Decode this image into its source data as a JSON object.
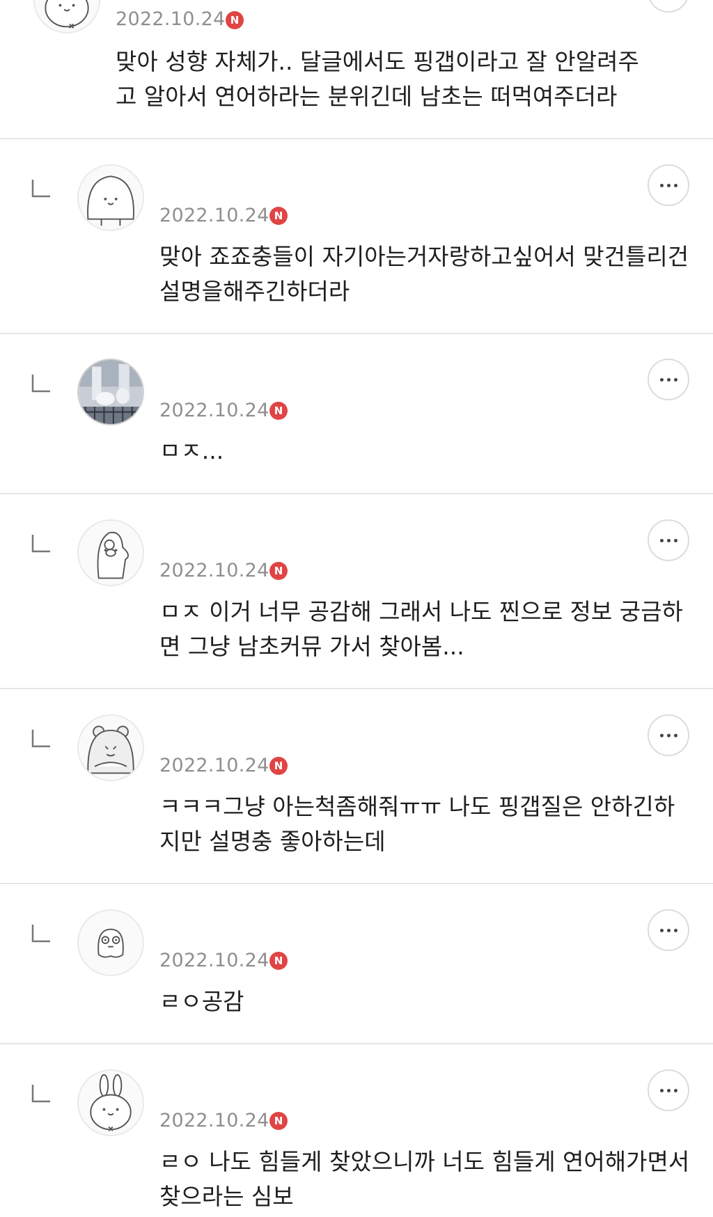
{
  "new_badge": "N",
  "comments": [
    {
      "date": "2022.10.24",
      "text": "맞아 성향 자체가.. 달글에서도 핑갭이라고 잘 안알려주고 알아서 연어하라는 분위긴데 남초는 떠먹여주더라",
      "avatar_icon": "bunny-character-icon"
    },
    {
      "date": "2022.10.24",
      "text": "맞아 죠죠충들이 자기아는거자랑하고싶어서 맞건틀리건 설명을해주긴하더라",
      "avatar_icon": "blob-character-icon"
    },
    {
      "date": "2022.10.24",
      "text": "ㅁㅈ...",
      "avatar_icon": "photo-avatar-icon"
    },
    {
      "date": "2022.10.24",
      "text": "ㅁㅈ 이거 너무 공감해 그래서 나도 찐으로 정보 궁금하면 그냥 남초커뮤 가서 찾아봄...",
      "avatar_icon": "penguin-character-icon"
    },
    {
      "date": "2022.10.24",
      "text": "ㅋㅋㅋ그냥 아는척좀해줘ㅠㅠ 나도 핑갭질은 안하긴하지만 설명충 좋아하는데",
      "avatar_icon": "hamster-character-icon"
    },
    {
      "date": "2022.10.24",
      "text": "ㄹㅇ공감",
      "avatar_icon": "ghost-character-icon"
    },
    {
      "date": "2022.10.24",
      "text": "ㄹㅇ 나도 힘들게 찾았으니까 너도 힘들게 연어해가면서 찾으라는 심보",
      "avatar_icon": "rabbit-character-icon"
    }
  ]
}
